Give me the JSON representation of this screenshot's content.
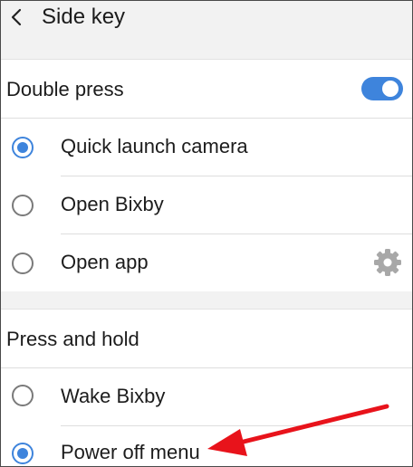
{
  "header": {
    "title": "Side key",
    "back_icon": "back-arrow-icon"
  },
  "double_press": {
    "label": "Double press",
    "toggle_on": true,
    "options": [
      {
        "label": "Quick launch camera",
        "selected": true
      },
      {
        "label": "Open Bixby",
        "selected": false
      },
      {
        "label": "Open app",
        "selected": false,
        "icon": "gear-icon"
      }
    ]
  },
  "press_and_hold": {
    "label": "Press and hold",
    "options": [
      {
        "label": "Wake Bixby",
        "selected": false
      },
      {
        "label": "Power off menu",
        "selected": true
      }
    ]
  },
  "colors": {
    "accent": "#3e84dc",
    "annotation_arrow": "#e8131b",
    "background": "#f2f2f2"
  }
}
